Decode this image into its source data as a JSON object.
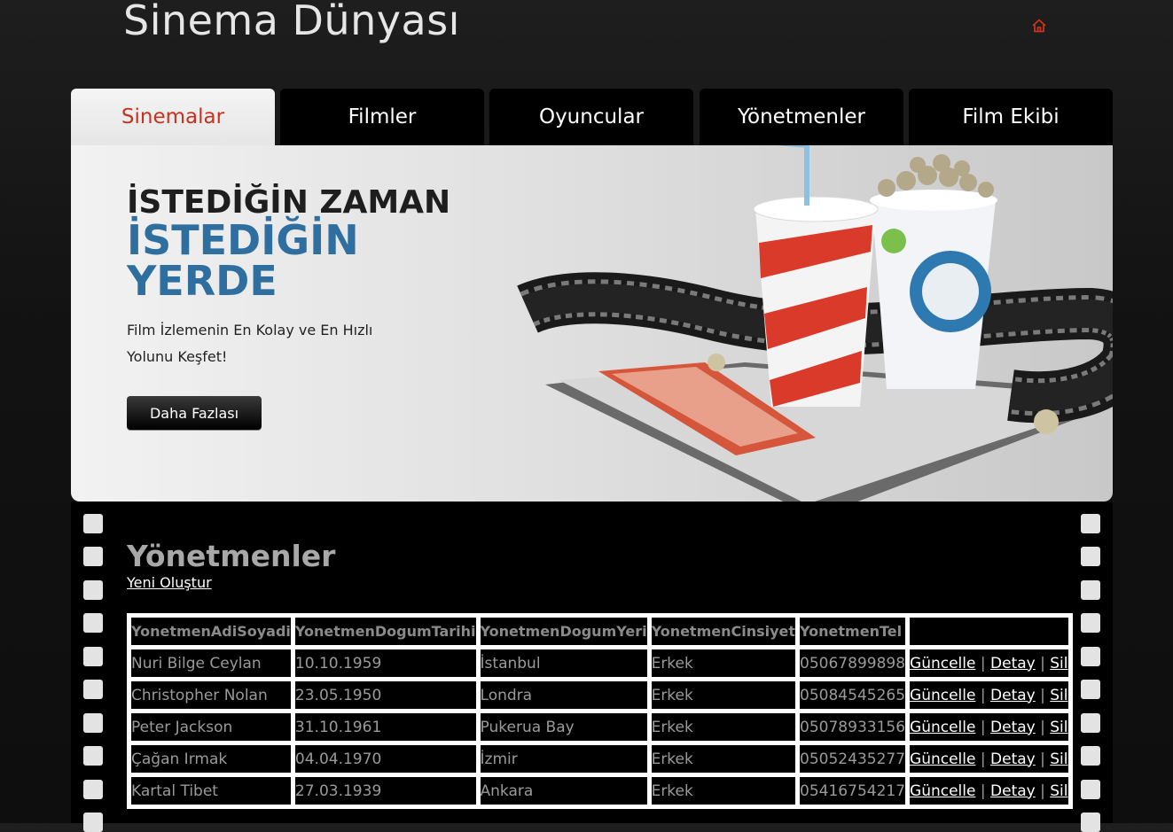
{
  "site": {
    "title": "Sinema Dünyası"
  },
  "tabs": [
    {
      "label": "Sinemalar",
      "active": true
    },
    {
      "label": "Filmler",
      "active": false
    },
    {
      "label": "Oyuncular",
      "active": false
    },
    {
      "label": "Yönetmenler",
      "active": false
    },
    {
      "label": "Film Ekibi",
      "active": false
    }
  ],
  "hero": {
    "line1": "İSTEDİĞİN ZAMAN",
    "line2": "İSTEDİĞİN YERDE",
    "subtitle": "Film İzlemenin En Kolay ve En Hızlı Yolunu Keşfet!",
    "button": "Daha Fazlası"
  },
  "section": {
    "title": "Yönetmenler",
    "create_link": "Yeni Oluştur"
  },
  "table": {
    "headers": [
      "YonetmenAdiSoyadi",
      "YonetmenDogumTarihi",
      "YonetmenDogumYeri",
      "YonetmenCinsiyet",
      "YonetmenTel",
      ""
    ],
    "actions": {
      "edit": "Güncelle",
      "detail": "Detay",
      "delete": "Sil",
      "separator": "|"
    },
    "rows": [
      [
        "Nuri Bilge Ceylan",
        "10.10.1959",
        "İstanbul",
        "Erkek",
        "05067899898"
      ],
      [
        "Christopher Nolan",
        "23.05.1950",
        "Londra",
        "Erkek",
        "05084545265"
      ],
      [
        "Peter Jackson",
        "31.10.1961",
        "Pukerua Bay",
        "Erkek",
        "05078933156"
      ],
      [
        "Çağan Irmak",
        "04.04.1970",
        "İzmir",
        "Erkek",
        "05052435277"
      ],
      [
        "Kartal Tibet",
        "27.03.1939",
        "Ankara",
        "Erkek",
        "05416754217"
      ]
    ]
  },
  "colors": {
    "accent": "#c8321e",
    "hero_blue": "#2e6fa0",
    "active_tab_bg": "#eeeeee"
  },
  "icons": {
    "home": "home-icon"
  }
}
